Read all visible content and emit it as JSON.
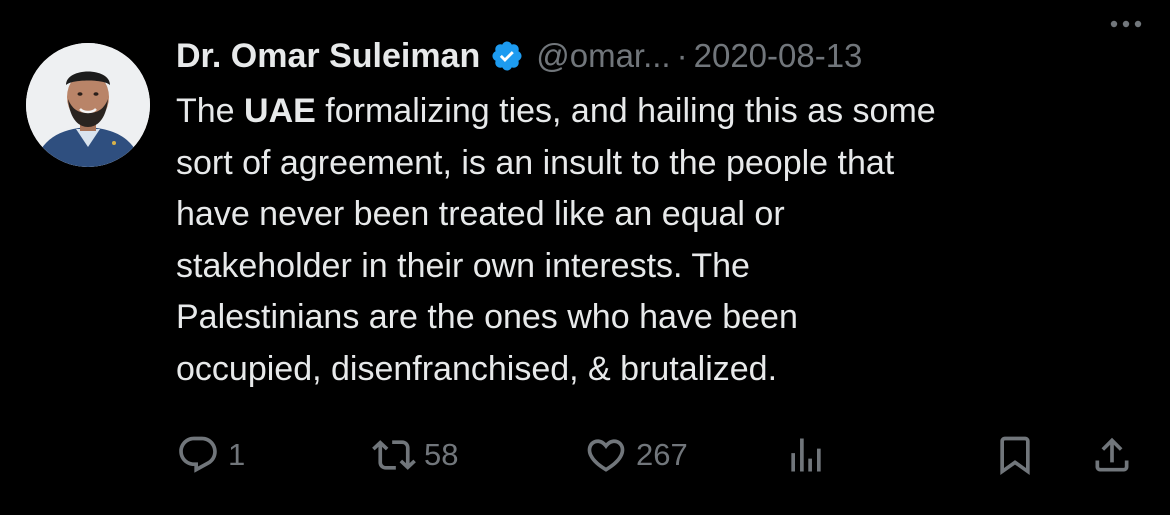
{
  "author": {
    "name": "Dr. Omar Suleiman",
    "handle": "@omar...",
    "verified": true,
    "avatar": "profile-photo"
  },
  "separator": "·",
  "date": "2020-08-13",
  "more_icon": "more-horizontal-icon",
  "body": {
    "line1_pre": "The ",
    "line1_bold": "UAE",
    "line1_post": " formalizing ties, and hailing this as some",
    "line2": "sort of agreement, is an insult to the people that",
    "line3": "have never been treated like an equal or",
    "line4": "stakeholder in their own interests. The",
    "line5": "Palestinians are the ones who have been",
    "line6": "occupied, disenfranchised, & brutalized."
  },
  "actions": {
    "reply": {
      "icon": "reply-icon",
      "count": "1"
    },
    "repost": {
      "icon": "repost-icon",
      "count": "58"
    },
    "like": {
      "icon": "heart-icon",
      "count": "267"
    },
    "views": {
      "icon": "analytics-icon"
    },
    "bookmark": {
      "icon": "bookmark-icon"
    },
    "share": {
      "icon": "share-icon"
    }
  },
  "colors": {
    "background": "#000000",
    "text": "#e7e9ea",
    "muted": "#71767b",
    "verified": "#1d9bf0"
  }
}
